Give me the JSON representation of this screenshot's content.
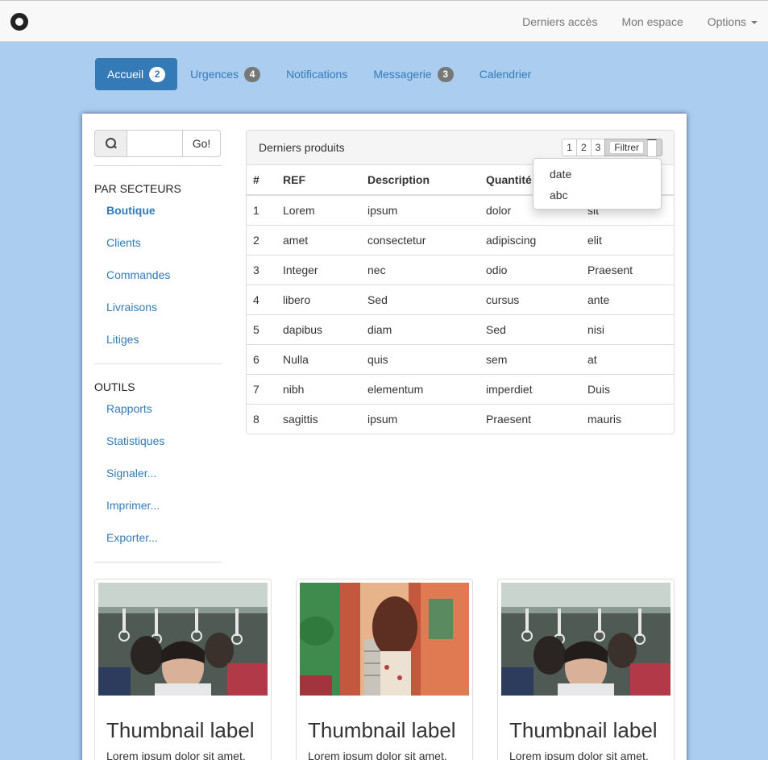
{
  "navbar": {
    "links": [
      "Derniers accès",
      "Mon espace",
      "Options"
    ]
  },
  "pills": [
    {
      "label": "Accueil",
      "badge": "2",
      "active": true
    },
    {
      "label": "Urgences",
      "badge": "4",
      "active": false
    },
    {
      "label": "Notifications",
      "badge": "",
      "active": false
    },
    {
      "label": "Messagerie",
      "badge": "3",
      "active": false
    },
    {
      "label": "Calendrier",
      "badge": "",
      "active": false
    }
  ],
  "search": {
    "value": "",
    "button": "Go!"
  },
  "sidebar": {
    "section1": {
      "title": "PAR SECTEURS",
      "items": [
        "Boutique",
        "Clients",
        "Commandes",
        "Livraisons",
        "Litiges"
      ]
    },
    "section2": {
      "title": "OUTILS",
      "items": [
        "Rapports",
        "Statistiques",
        "Signaler...",
        "Imprimer...",
        "Exporter..."
      ]
    }
  },
  "products": {
    "title": "Derniers produits",
    "pages": [
      "1",
      "2",
      "3"
    ],
    "filter_label": "Filtrer",
    "filter_options": [
      "date",
      "abc"
    ],
    "columns": [
      "#",
      "REF",
      "Description",
      "Quantité",
      ""
    ],
    "rows": [
      [
        "1",
        "Lorem",
        "ipsum",
        "dolor",
        "sit"
      ],
      [
        "2",
        "amet",
        "consectetur",
        "adipiscing",
        "elit"
      ],
      [
        "3",
        "Integer",
        "nec",
        "odio",
        "Praesent"
      ],
      [
        "4",
        "libero",
        "Sed",
        "cursus",
        "ante"
      ],
      [
        "5",
        "dapibus",
        "diam",
        "Sed",
        "nisi"
      ],
      [
        "6",
        "Nulla",
        "quis",
        "sem",
        "at"
      ],
      [
        "7",
        "nibh",
        "elementum",
        "imperdiet",
        "Duis"
      ],
      [
        "8",
        "sagittis",
        "ipsum",
        "Praesent",
        "mauris"
      ]
    ]
  },
  "thumbnails": [
    {
      "title": "Thumbnail label",
      "text": "Lorem ipsum dolor sit amet.",
      "image": "subway-crowd-photo"
    },
    {
      "title": "Thumbnail label",
      "text": "Lorem ipsum dolor sit amet.",
      "image": "curly-hair-woman-street-photo"
    },
    {
      "title": "Thumbnail label",
      "text": "Lorem ipsum dolor sit amet.",
      "image": "subway-crowd-photo"
    }
  ],
  "colors": {
    "background": "#abcdf0",
    "accent": "#337ab7",
    "badge": "#777777"
  }
}
